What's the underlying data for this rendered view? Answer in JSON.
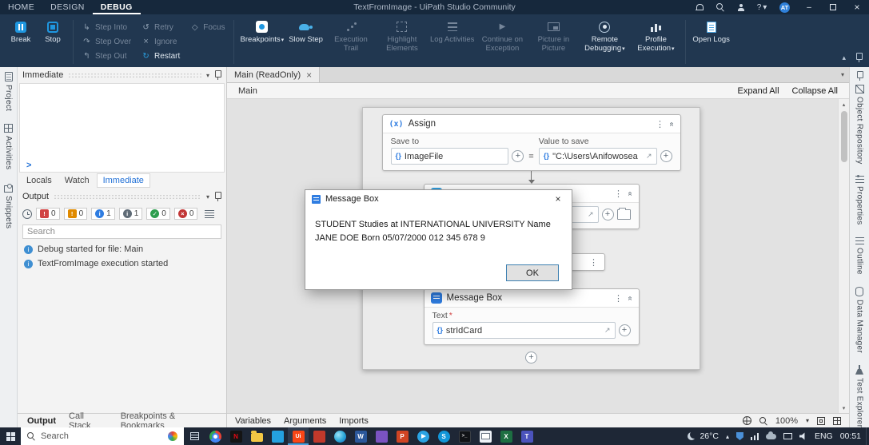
{
  "colors": {
    "titlebar_bg": "#16283c",
    "ribbon_bg": "#213750",
    "accent_blue": "#1f97e0",
    "link_blue": "#1f6fd6",
    "uipath_orange": "#fa4616",
    "canvas_bg": "#e2e2e2",
    "taskbar_bg": "#1e2736",
    "error_red": "#d14343",
    "warning_orange": "#e08a00",
    "success_green": "#2e9e4f"
  },
  "titlebar": {
    "menus": [
      {
        "label": "HOME"
      },
      {
        "label": "DESIGN"
      },
      {
        "label": "DEBUG"
      }
    ],
    "active_menu": "DEBUG",
    "title": "TextFromImage - UiPath Studio Community",
    "avatar_initials": "AT"
  },
  "ribbon": {
    "primary": [
      {
        "label": "Break"
      },
      {
        "label": "Stop"
      }
    ],
    "small": [
      {
        "label": "Step Into",
        "enabled": false
      },
      {
        "label": "Step Over",
        "enabled": false
      },
      {
        "label": "Step Out",
        "enabled": false
      },
      {
        "label": "Retry",
        "enabled": false
      },
      {
        "label": "Ignore",
        "enabled": false
      },
      {
        "label": "Restart",
        "enabled": true
      },
      {
        "label": "Focus",
        "enabled": false
      }
    ],
    "large": [
      {
        "label": "Breakpoints",
        "dropdown": true,
        "enabled": true
      },
      {
        "label": "Slow Step",
        "enabled": true
      },
      {
        "label": "Execution Trail",
        "enabled": false
      },
      {
        "label": "Highlight Elements",
        "enabled": false
      },
      {
        "label": "Log Activities",
        "enabled": false
      },
      {
        "label": "Continue on Exception",
        "enabled": false
      },
      {
        "label": "Picture in Picture",
        "enabled": false
      },
      {
        "label": "Remote Debugging",
        "dropdown": true,
        "enabled": true
      },
      {
        "label": "Profile Execution",
        "dropdown": true,
        "enabled": true
      },
      {
        "label": "Open Logs",
        "enabled": true
      }
    ]
  },
  "left_rail": {
    "items": [
      {
        "label": "Project"
      },
      {
        "label": "Activities"
      },
      {
        "label": "Snippets"
      }
    ]
  },
  "immediate_panel": {
    "title": "Immediate",
    "prompt": ">",
    "tabs": [
      {
        "label": "Locals"
      },
      {
        "label": "Watch"
      },
      {
        "label": "Immediate"
      }
    ],
    "active_tab": "Immediate"
  },
  "output_panel": {
    "title": "Output",
    "badges": [
      {
        "kind": "error",
        "count": "0"
      },
      {
        "kind": "warning",
        "count": "0"
      },
      {
        "kind": "info",
        "count": "1"
      },
      {
        "kind": "trace",
        "count": "1"
      },
      {
        "kind": "success",
        "count": "0"
      },
      {
        "kind": "failure",
        "count": "0"
      }
    ],
    "search_placeholder": "Search",
    "messages": [
      {
        "text": "Debug started for file: Main"
      },
      {
        "text": "TextFromImage execution started"
      }
    ],
    "tabs": [
      {
        "label": "Output"
      },
      {
        "label": "Call Stack"
      },
      {
        "label": "Breakpoints & Bookmarks"
      }
    ],
    "active_tab": "Output"
  },
  "designer": {
    "doc_tab": "Main (ReadOnly)",
    "breadcrumb": "Main",
    "expand_all": "Expand All",
    "collapse_all": "Collapse All",
    "bottom_links": [
      {
        "label": "Variables"
      },
      {
        "label": "Arguments"
      },
      {
        "label": "Imports"
      }
    ],
    "zoom": "100%"
  },
  "workflow": {
    "assign": {
      "icon": "(x)",
      "title": "Assign",
      "save_to_label": "Save to",
      "value_label": "Value to save",
      "save_to_value": "ImageFile",
      "equals": "=",
      "value_value": "\"C:\\Users\\Anifowosea"
    },
    "message_box": {
      "title": "Message Box",
      "text_label": "Text",
      "required_mark": "*",
      "text_value": "strIdCard"
    }
  },
  "dialog": {
    "title": "Message Box",
    "body": "STUDENT Studies at INTERNATIONAL UNIVERSITY Name JANE DOE Born 05/07/2000 012 345 678 9",
    "ok_label": "OK"
  },
  "right_rail": {
    "items": [
      {
        "label": "Object Repository"
      },
      {
        "label": "Properties"
      },
      {
        "label": "Outline"
      },
      {
        "label": "Data Manager"
      },
      {
        "label": "Test Explorer"
      }
    ]
  },
  "taskbar": {
    "search_placeholder": "Search",
    "apps": [
      {
        "name": "chrome"
      },
      {
        "name": "netflix"
      },
      {
        "name": "file-explorer"
      },
      {
        "name": "vscode"
      },
      {
        "name": "uipath",
        "active": true
      },
      {
        "name": "store"
      },
      {
        "name": "edge"
      },
      {
        "name": "word"
      },
      {
        "name": "visual-studio"
      },
      {
        "name": "powerpoint"
      },
      {
        "name": "telegram"
      },
      {
        "name": "skype"
      },
      {
        "name": "terminal"
      },
      {
        "name": "mail"
      },
      {
        "name": "excel"
      },
      {
        "name": "teams"
      }
    ],
    "tray": {
      "temperature": "26°C",
      "icons": [
        "hidden-icons-chevron",
        "security-shield",
        "network",
        "onedrive",
        "display",
        "volume"
      ],
      "language": "ENG",
      "time": "00:51"
    }
  }
}
